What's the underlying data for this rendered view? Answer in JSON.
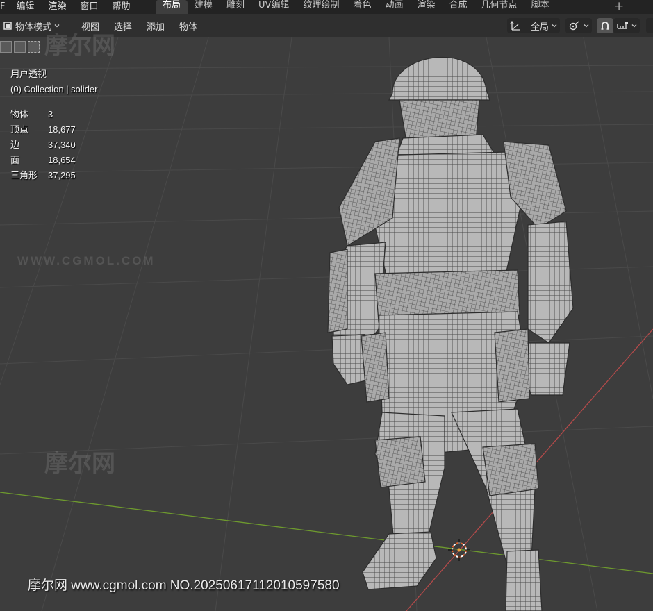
{
  "menu": {
    "items": [
      {
        "label": "F",
        "name": "menu-file"
      },
      {
        "label": "编辑",
        "name": "menu-edit"
      },
      {
        "label": "渲染",
        "name": "menu-render"
      },
      {
        "label": "窗口",
        "name": "menu-window"
      },
      {
        "label": "帮助",
        "name": "menu-help"
      }
    ]
  },
  "workspaces": {
    "tabs": [
      "布局",
      "建模",
      "雕刻",
      "UV编辑",
      "纹理绘制",
      "着色",
      "动画",
      "渲染",
      "合成",
      "几何节点",
      "脚本"
    ],
    "active": "布局",
    "add_label": "+"
  },
  "header": {
    "mode_label": "物体模式",
    "view_label": "视图",
    "select_label": "选择",
    "add_label": "添加",
    "object_label": "物体",
    "orientation_label": "全局",
    "icons": [
      "object-mode-icon",
      "transform-orientation-icon",
      "link-icon",
      "snap-magnet-icon",
      "snap-increment-icon"
    ]
  },
  "viewport": {
    "view_name": "用户透视",
    "collection": "(0) Collection | solider",
    "stats": [
      {
        "label": "物体",
        "value": "3"
      },
      {
        "label": "顶点",
        "value": "18,677"
      },
      {
        "label": "边",
        "value": "37,340"
      },
      {
        "label": "面",
        "value": "18,654"
      },
      {
        "label": "三角形",
        "value": "37,295"
      }
    ]
  },
  "watermarks": {
    "bottom_text": "摩尔网 www.cgmol.com NO.20250617112010597580",
    "url_text": "WWW.CGMOL.COM",
    "logo_text": "摩尔网"
  },
  "colors": {
    "menubar_bg": "#232323",
    "header_bg": "#2f2f2f",
    "viewport_bg": "#3d3d3d",
    "x_axis": "#b34a4a",
    "y_axis": "#6e9a2e",
    "cursor": "#e8622a"
  }
}
